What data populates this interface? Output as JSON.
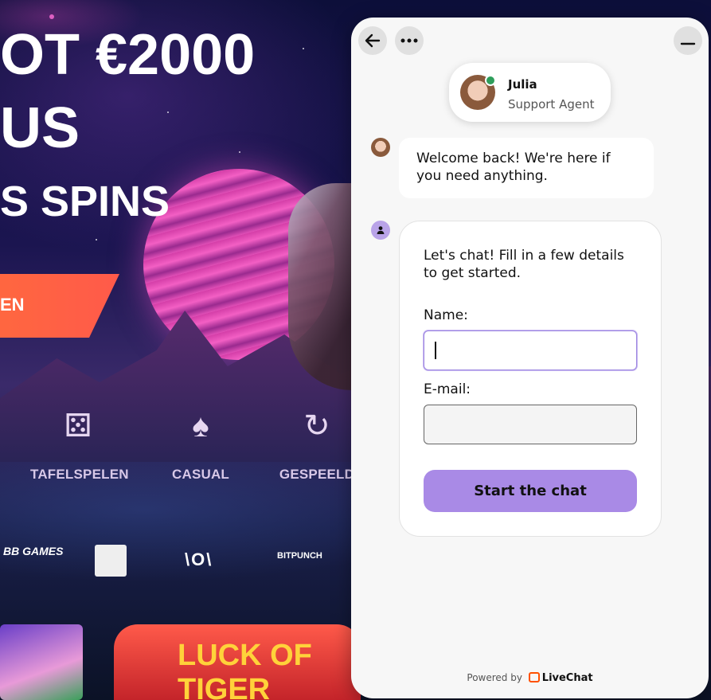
{
  "background_page": {
    "hero_line_1": "OT €2000",
    "hero_line_2": "US",
    "hero_line_3": "S SPINS",
    "cta_label": "EN",
    "categories": [
      {
        "label": "TAFELSPELEN",
        "icon": "dice-icon"
      },
      {
        "label": "CASUAL",
        "icon": "cards-icon"
      },
      {
        "label": "GESPEELD",
        "icon": "history-icon"
      }
    ],
    "providers": [
      "BB GAMES",
      "",
      "\\O\\",
      "BITPUNCH"
    ],
    "game_thumb_title": "LUCK OF TIGER"
  },
  "chat": {
    "agent": {
      "name": "Julia",
      "role": "Support Agent",
      "status_color": "#2e9e5b"
    },
    "welcome_message": "Welcome back! We're here if you need anything.",
    "form": {
      "intro": "Let's chat! Fill in a few details to get started.",
      "name_label": "Name:",
      "name_value": "",
      "email_label": "E-mail:",
      "email_value": "",
      "submit_label": "Start the chat"
    },
    "footer": {
      "powered_by": "Powered by",
      "brand": "LiveChat"
    },
    "accent_color": "#a98ae6"
  }
}
